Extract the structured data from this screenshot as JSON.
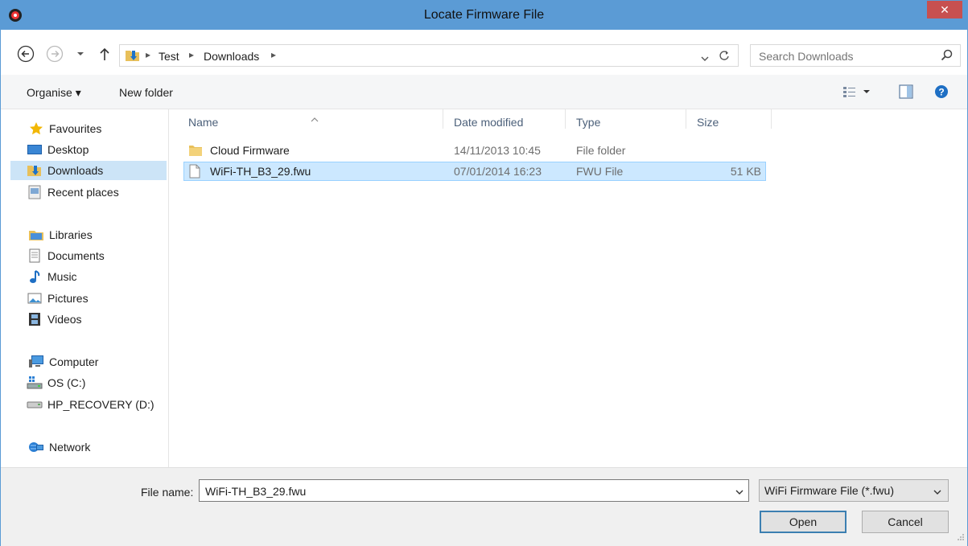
{
  "window": {
    "title": "Locate Firmware File",
    "close_label": "✕"
  },
  "address": {
    "breadcrumb": [
      "Test",
      "Downloads"
    ],
    "search_placeholder": "Search Downloads"
  },
  "toolbar": {
    "organise_label": "Organise ▾",
    "new_folder_label": "New folder"
  },
  "sidebar": {
    "favourites": "Favourites",
    "desktop": "Desktop",
    "downloads": "Downloads",
    "recent": "Recent places",
    "libraries": "Libraries",
    "documents": "Documents",
    "music": "Music",
    "pictures": "Pictures",
    "videos": "Videos",
    "computer": "Computer",
    "os": "OS (C:)",
    "recovery": "HP_RECOVERY (D:)",
    "network": "Network"
  },
  "columns": {
    "name": "Name",
    "date": "Date modified",
    "type": "Type",
    "size": "Size"
  },
  "files": [
    {
      "name": "Cloud Firmware",
      "date": "14/11/2013 10:45",
      "type": "File folder",
      "size": ""
    },
    {
      "name": "WiFi-TH_B3_29.fwu",
      "date": "07/01/2014 16:23",
      "type": "FWU File",
      "size": "51 KB"
    }
  ],
  "footer": {
    "file_name_label": "File name:",
    "file_name_value": "WiFi-TH_B3_29.fwu",
    "file_type": "WiFi Firmware File (*.fwu)",
    "open_label": "Open",
    "cancel_label": "Cancel"
  },
  "colors": {
    "titlebar": "#5b9bd5",
    "selection": "#cce8ff",
    "close": "#c75050"
  }
}
